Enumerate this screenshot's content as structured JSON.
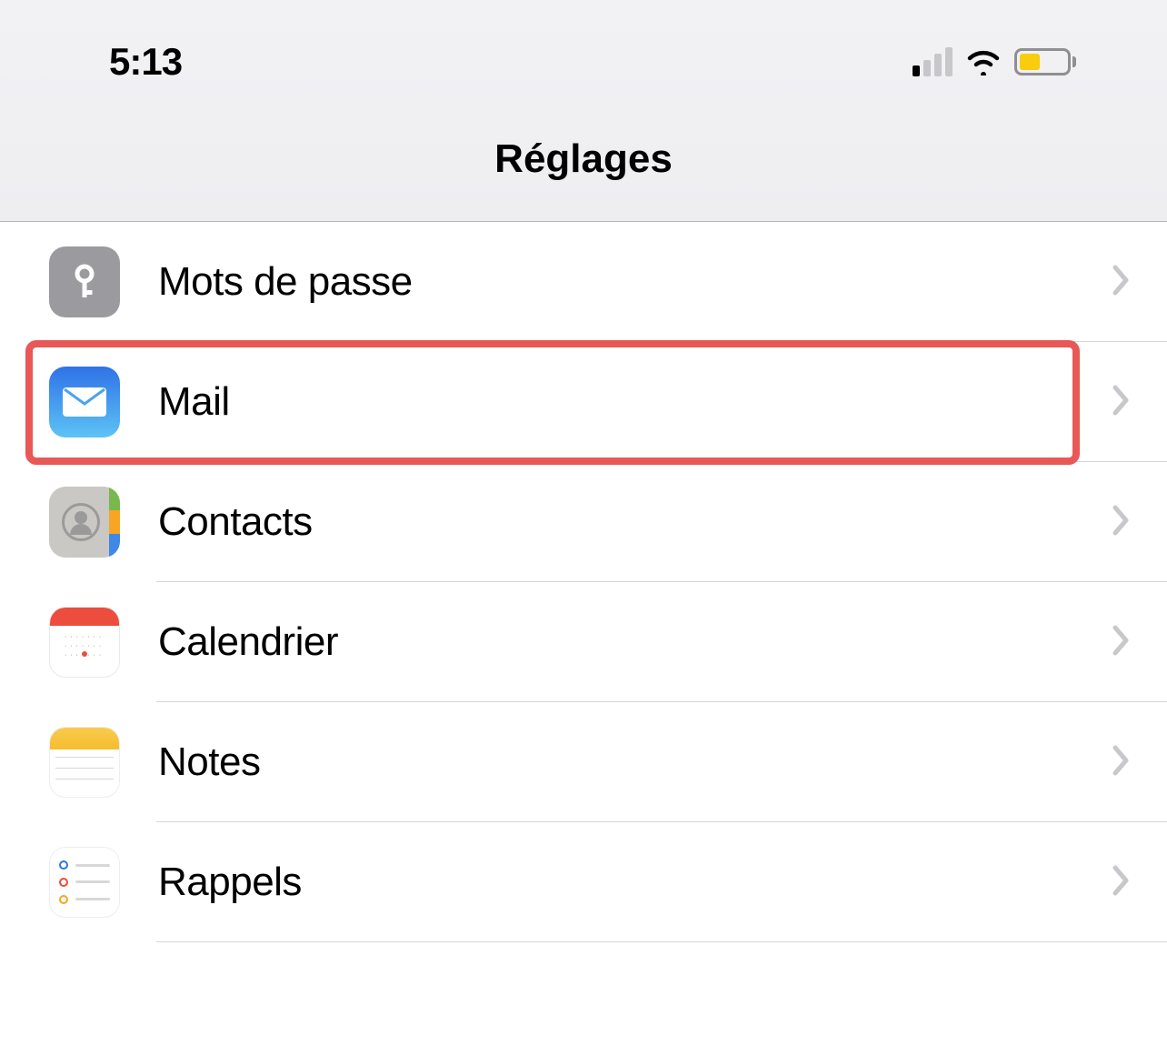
{
  "status_bar": {
    "time": "5:13"
  },
  "header": {
    "title": "Réglages"
  },
  "settings": {
    "items": [
      {
        "key": "passwords",
        "label": "Mots de passe",
        "icon": "key-icon",
        "highlighted": false
      },
      {
        "key": "mail",
        "label": "Mail",
        "icon": "mail-icon",
        "highlighted": true
      },
      {
        "key": "contacts",
        "label": "Contacts",
        "icon": "contacts-icon",
        "highlighted": false
      },
      {
        "key": "calendar",
        "label": "Calendrier",
        "icon": "calendar-icon",
        "highlighted": false
      },
      {
        "key": "notes",
        "label": "Notes",
        "icon": "notes-icon",
        "highlighted": false
      },
      {
        "key": "reminders",
        "label": "Rappels",
        "icon": "reminders-icon",
        "highlighted": false
      }
    ]
  }
}
